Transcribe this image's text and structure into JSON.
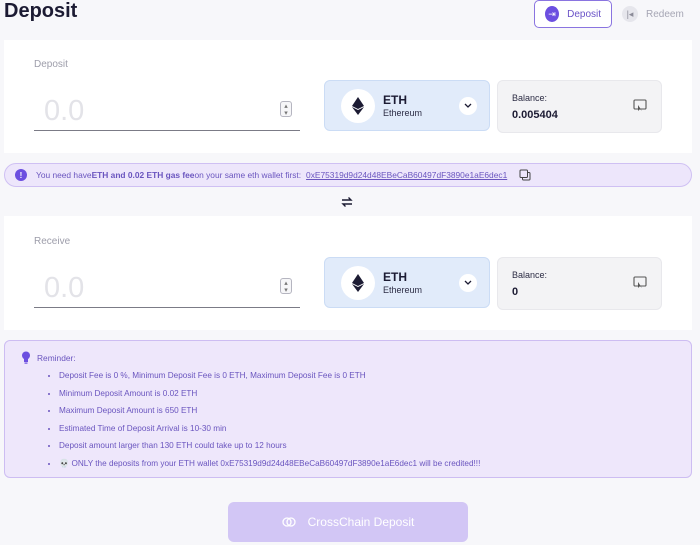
{
  "page": {
    "title": "Deposit"
  },
  "tabs": [
    {
      "label": "Deposit",
      "icon": "deposit-arrow-icon"
    },
    {
      "label": "Redeem",
      "icon": "redeem-arrow-icon"
    }
  ],
  "deposit_panel": {
    "label": "Deposit",
    "amount": "0.0",
    "token": {
      "symbol": "ETH",
      "name": "Ethereum",
      "icon": "ethereum-icon"
    },
    "balance_label": "Balance:",
    "balance_value": "0.005404"
  },
  "notice": {
    "text_prefix": "You need have ",
    "text_bold": "ETH and 0.02 ETH gas fee",
    "text_suffix": " on your same eth wallet first:",
    "address": "0xE75319d9d24d48EBeCaB60497dF3890e1aE6dec1"
  },
  "receive_panel": {
    "label": "Receive",
    "amount": "0.0",
    "token": {
      "symbol": "ETH",
      "name": "Ethereum",
      "icon": "ethereum-icon"
    },
    "balance_label": "Balance:",
    "balance_value": "0"
  },
  "reminder": {
    "title": "Reminder:",
    "items": [
      "Deposit Fee is 0 %, Minimum Deposit Fee is 0 ETH, Maximum Deposit Fee is 0 ETH",
      "Minimum Deposit Amount is 0.02 ETH",
      "Maximum Deposit Amount is 650 ETH",
      "Estimated Time of Deposit Arrival is 10-30 min",
      "Deposit amount larger than 130 ETH could take up to 12 hours",
      "💀 ONLY the deposits from your ETH wallet 0xE75319d9d24d48EBeCaB60497dF3890e1aE6dec1 will be credited!!!"
    ]
  },
  "action": {
    "label": "CrossChain Deposit"
  },
  "colors": {
    "accent": "#6c4fe0",
    "notice_bg": "#ede6fb",
    "token_bg": "#e1ebfa",
    "button_bg": "#d2c6f5"
  }
}
